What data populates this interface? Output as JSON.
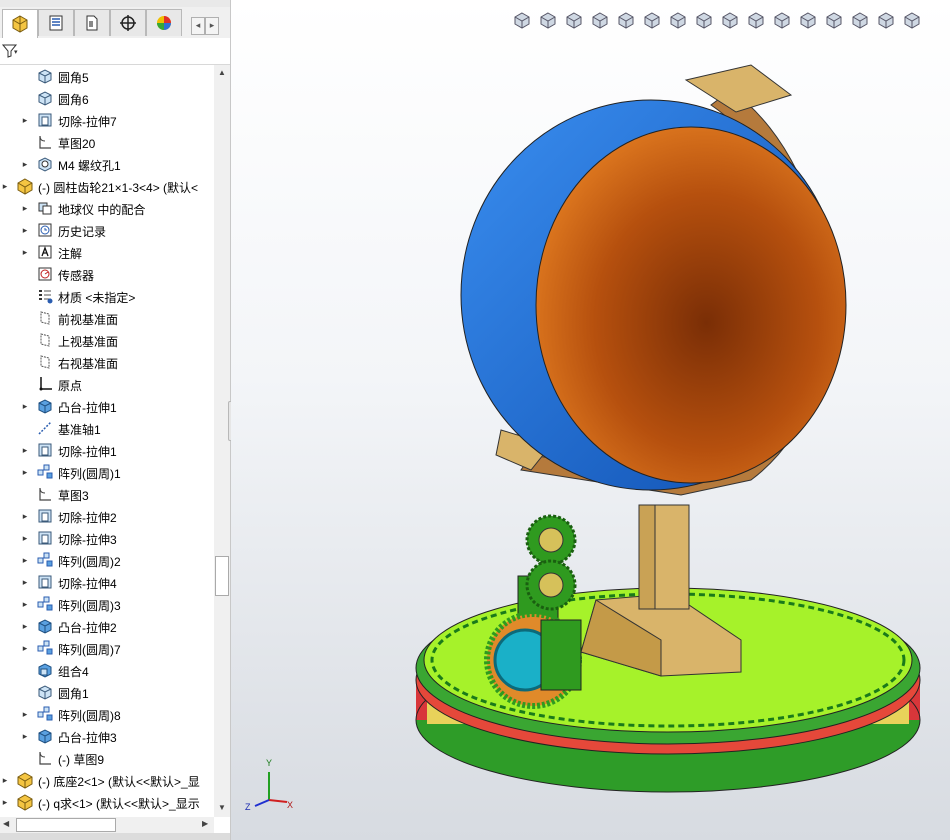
{
  "window": {
    "top_tabs": [
      "",
      "",
      "",
      "",
      ""
    ]
  },
  "feature_manager": {
    "tabs": [
      {
        "icon": "featuremanager-tree-icon",
        "active": true
      },
      {
        "icon": "property-manager-icon",
        "active": false
      },
      {
        "icon": "configuration-manager-icon",
        "active": false
      },
      {
        "icon": "dimxpert-manager-icon",
        "active": false
      },
      {
        "icon": "display-manager-icon",
        "active": false
      }
    ],
    "filter_icon": "filter-icon",
    "tree": [
      {
        "label": "圆角5",
        "icon": "fillet-icon",
        "arrow": false,
        "level": 2
      },
      {
        "label": "圆角6",
        "icon": "fillet-icon",
        "arrow": false,
        "level": 2
      },
      {
        "label": "切除-拉伸7",
        "icon": "cut-extrude-icon",
        "arrow": true,
        "level": 2
      },
      {
        "label": "草图20",
        "icon": "sketch-icon",
        "arrow": false,
        "level": 2
      },
      {
        "label": "M4 螺纹孔1",
        "icon": "hole-wizard-icon",
        "arrow": true,
        "level": 2
      },
      {
        "label": "(-) 圆柱齿轮21×1-3<4> (默认<",
        "icon": "part-component-icon",
        "arrow": true,
        "level": 1
      },
      {
        "label": "地球仪 中的配合",
        "icon": "mates-icon",
        "arrow": true,
        "level": 2
      },
      {
        "label": "历史记录",
        "icon": "history-icon",
        "arrow": true,
        "level": 2
      },
      {
        "label": "注解",
        "icon": "annotations-icon",
        "arrow": true,
        "level": 2
      },
      {
        "label": "传感器",
        "icon": "sensors-icon",
        "arrow": false,
        "level": 2
      },
      {
        "label": "材质 <未指定>",
        "icon": "material-icon",
        "arrow": false,
        "level": 2
      },
      {
        "label": "前视基准面",
        "icon": "plane-icon",
        "arrow": false,
        "level": 2
      },
      {
        "label": "上视基准面",
        "icon": "plane-icon",
        "arrow": false,
        "level": 2
      },
      {
        "label": "右视基准面",
        "icon": "plane-icon",
        "arrow": false,
        "level": 2
      },
      {
        "label": "原点",
        "icon": "origin-icon",
        "arrow": false,
        "level": 2
      },
      {
        "label": "凸台-拉伸1",
        "icon": "boss-extrude-icon",
        "arrow": true,
        "level": 2
      },
      {
        "label": "基准轴1",
        "icon": "axis-icon",
        "arrow": false,
        "level": 2
      },
      {
        "label": "切除-拉伸1",
        "icon": "cut-extrude-icon",
        "arrow": true,
        "level": 2
      },
      {
        "label": "阵列(圆周)1",
        "icon": "circular-pattern-icon",
        "arrow": true,
        "level": 2
      },
      {
        "label": "草图3",
        "icon": "sketch-icon",
        "arrow": false,
        "level": 2
      },
      {
        "label": "切除-拉伸2",
        "icon": "cut-extrude-icon",
        "arrow": true,
        "level": 2
      },
      {
        "label": "切除-拉伸3",
        "icon": "cut-extrude-icon",
        "arrow": true,
        "level": 2
      },
      {
        "label": "阵列(圆周)2",
        "icon": "circular-pattern-icon",
        "arrow": true,
        "level": 2
      },
      {
        "label": "切除-拉伸4",
        "icon": "cut-extrude-icon",
        "arrow": true,
        "level": 2
      },
      {
        "label": "阵列(圆周)3",
        "icon": "circular-pattern-icon",
        "arrow": true,
        "level": 2
      },
      {
        "label": "凸台-拉伸2",
        "icon": "boss-extrude-icon",
        "arrow": true,
        "level": 2
      },
      {
        "label": "阵列(圆周)7",
        "icon": "circular-pattern-icon",
        "arrow": true,
        "level": 2
      },
      {
        "label": "组合4",
        "icon": "combine-icon",
        "arrow": false,
        "level": 2
      },
      {
        "label": "圆角1",
        "icon": "fillet-icon",
        "arrow": false,
        "level": 2
      },
      {
        "label": "阵列(圆周)8",
        "icon": "circular-pattern-icon",
        "arrow": true,
        "level": 2
      },
      {
        "label": "凸台-拉伸3",
        "icon": "boss-extrude-icon",
        "arrow": true,
        "level": 2
      },
      {
        "label": "(-) 草图9",
        "icon": "sketch-icon",
        "arrow": false,
        "level": 2
      },
      {
        "label": "(-) 底座2<1> (默认<<默认>_显",
        "icon": "part-component-icon",
        "arrow": true,
        "level": 1
      },
      {
        "label": "(-) q求<1> (默认<<默认>_显示",
        "icon": "part-component-icon",
        "arrow": true,
        "level": 1
      }
    ]
  },
  "heads_up_toolbar": [
    "view-orientation-icon",
    "display-style-icon",
    "hide-show-icon",
    "zoom-to-area-icon",
    "section-view-icon",
    "dynamic-annotation-icon",
    "mirror-view-icon",
    "standard-views-icon",
    "rotate-view-icon",
    "zoom-to-fit-icon",
    "zoom-in-out-icon",
    "edit-appearance-icon",
    "apply-scene-icon",
    "view-settings-icon",
    "view-dropdown-icon",
    "display-pane-icon"
  ],
  "triad": {
    "x": "X",
    "y": "Y",
    "z": "Z"
  },
  "colors": {
    "globe_blue": "#1f6fd6",
    "globe_orange": "#c95a10",
    "base_green": "#a6f22a",
    "ring_red": "#e5483a",
    "stand_tan": "#d9b46a",
    "arc_brown": "#b57a3c",
    "gear_green": "#2f9a1f"
  }
}
